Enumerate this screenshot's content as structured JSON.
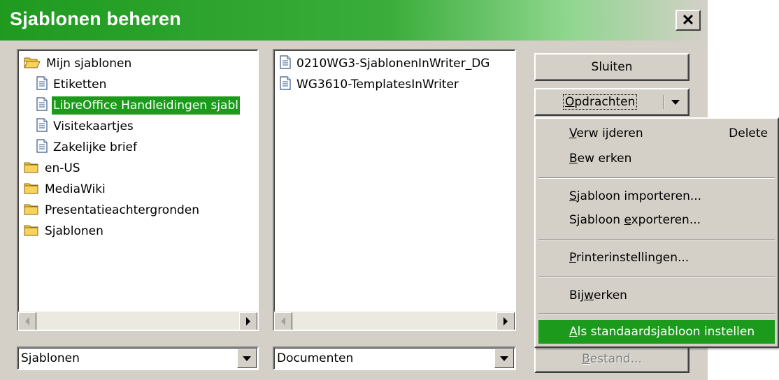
{
  "dialog": {
    "title": "Sjablonen beheren",
    "close_label": "✕"
  },
  "left_list": {
    "items": [
      {
        "label": "Mijn sjablonen",
        "icon": "folder-open-icon",
        "indent": 0,
        "selected": false
      },
      {
        "label": "Etiketten",
        "icon": "document-icon",
        "indent": 1,
        "selected": false
      },
      {
        "label": "LibreOffice Handleidingen sjabl",
        "icon": "document-icon",
        "indent": 1,
        "selected": true
      },
      {
        "label": "Visitekaartjes",
        "icon": "document-icon",
        "indent": 1,
        "selected": false
      },
      {
        "label": "Zakelijke brief",
        "icon": "document-icon",
        "indent": 1,
        "selected": false
      },
      {
        "label": "en-US",
        "icon": "folder-icon",
        "indent": 0,
        "selected": false
      },
      {
        "label": "MediaWiki",
        "icon": "folder-icon",
        "indent": 0,
        "selected": false
      },
      {
        "label": "Presentatieachtergronden",
        "icon": "folder-icon",
        "indent": 0,
        "selected": false
      },
      {
        "label": "Sjablonen",
        "icon": "folder-icon",
        "indent": 0,
        "selected": false
      }
    ],
    "dropdown_value": "Sjablonen"
  },
  "mid_list": {
    "items": [
      {
        "label": "0210WG3-SjablonenInWriter_DG",
        "icon": "document-icon"
      },
      {
        "label": "WG3610-TemplatesInWriter",
        "icon": "document-icon"
      }
    ],
    "dropdown_value": "Documenten"
  },
  "buttons": {
    "close": "Sluiten",
    "commands_pre": "",
    "commands_mnemonic": "O",
    "commands_post": "pdrachten",
    "file_pre": "",
    "file_mnemonic": "B",
    "file_post": "estand..."
  },
  "menu": {
    "items": [
      {
        "pre": "",
        "mn": "V",
        "post": "erw ijderen",
        "shortcut": "Delete",
        "highlighted": false
      },
      {
        "pre": "",
        "mn": "B",
        "post": "ew erken",
        "shortcut": "",
        "highlighted": false
      },
      {
        "pre": "",
        "mn": "S",
        "post": "jabloon importeren...",
        "shortcut": "",
        "highlighted": false
      },
      {
        "pre": "Sjabloon ",
        "mn": "e",
        "post": "xporteren...",
        "shortcut": "",
        "highlighted": false
      },
      {
        "pre": "",
        "mn": "P",
        "post": "rinterinstellingen...",
        "shortcut": "",
        "highlighted": false
      },
      {
        "pre": "Bij",
        "mn": "w",
        "post": "erken",
        "shortcut": "",
        "highlighted": false
      },
      {
        "pre": "",
        "mn": "A",
        "post": "ls standaardsjabloon instellen",
        "shortcut": "",
        "highlighted": true
      }
    ]
  },
  "colors": {
    "title_green": "#1f9a1f",
    "selection_green": "#1c9a1c",
    "face": "#d4d0c8"
  }
}
